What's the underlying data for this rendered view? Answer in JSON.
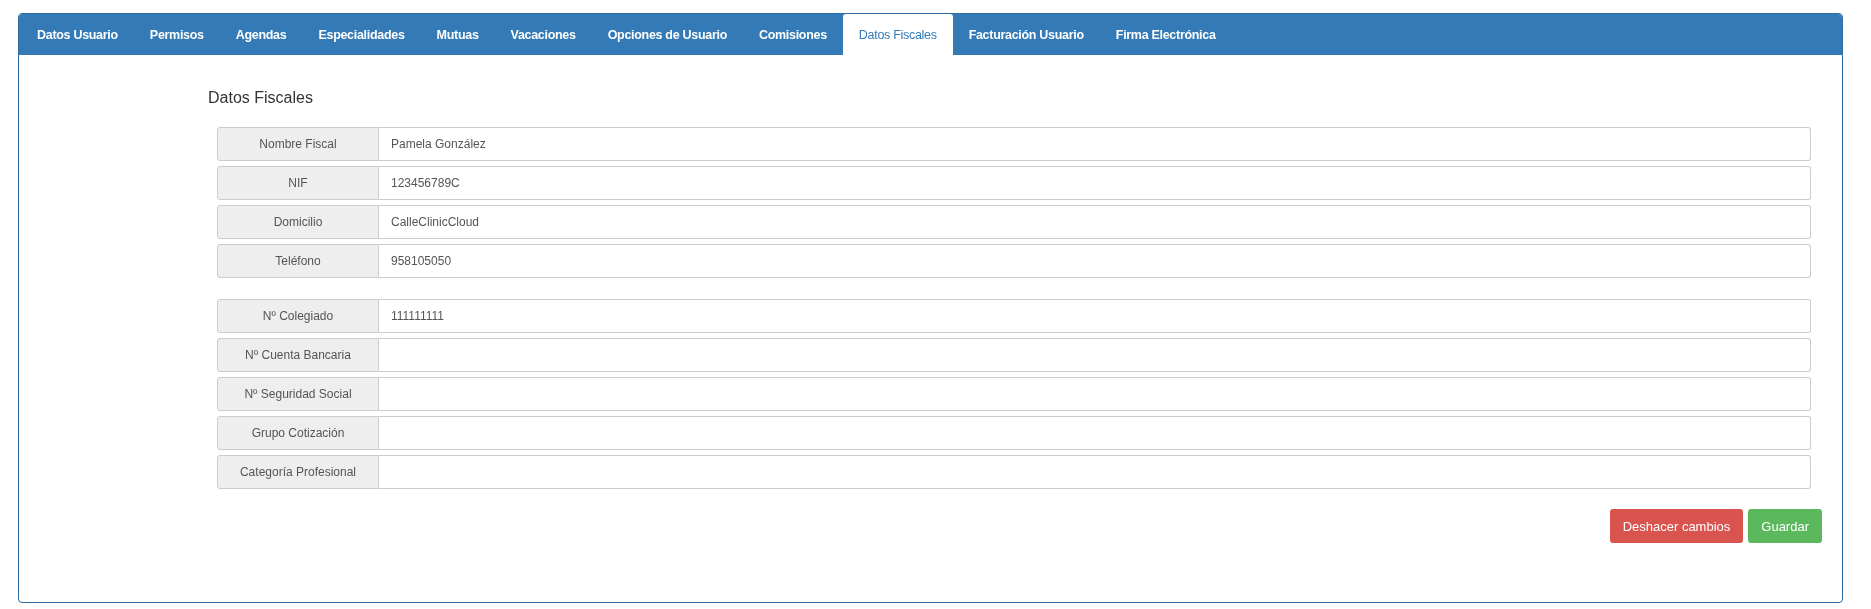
{
  "tabs": [
    {
      "label": "Datos Usuario",
      "selected": false
    },
    {
      "label": "Permisos",
      "selected": false
    },
    {
      "label": "Agendas",
      "selected": false
    },
    {
      "label": "Especialidades",
      "selected": false
    },
    {
      "label": "Mutuas",
      "selected": false
    },
    {
      "label": "Vacaciones",
      "selected": false
    },
    {
      "label": "Opciones de Usuario",
      "selected": false
    },
    {
      "label": "Comisiones",
      "selected": false
    },
    {
      "label": "Datos Fiscales",
      "selected": true
    },
    {
      "label": "Facturación Usuario",
      "selected": false
    },
    {
      "label": "Firma Electrónica",
      "selected": false
    }
  ],
  "section_title": "Datos Fiscales",
  "groups": [
    {
      "fields": [
        {
          "label": "Nombre Fiscal",
          "value": "Pamela González"
        },
        {
          "label": "NIF",
          "value": "123456789C"
        },
        {
          "label": "Domicilio",
          "value": "CalleClinicCloud"
        },
        {
          "label": "Teléfono",
          "value": "958105050"
        }
      ]
    },
    {
      "fields": [
        {
          "label": "Nº Colegiado",
          "value": "111111111"
        },
        {
          "label": "Nº Cuenta Bancaria"
        },
        {
          "label": "Nº Seguridad Social"
        },
        {
          "label": "Grupo Cotización"
        },
        {
          "label": "Categoría Profesional"
        }
      ]
    }
  ],
  "buttons": [
    {
      "label": "Deshacer cambios",
      "kind": "danger"
    },
    {
      "label": "Guardar",
      "kind": "success"
    }
  ]
}
